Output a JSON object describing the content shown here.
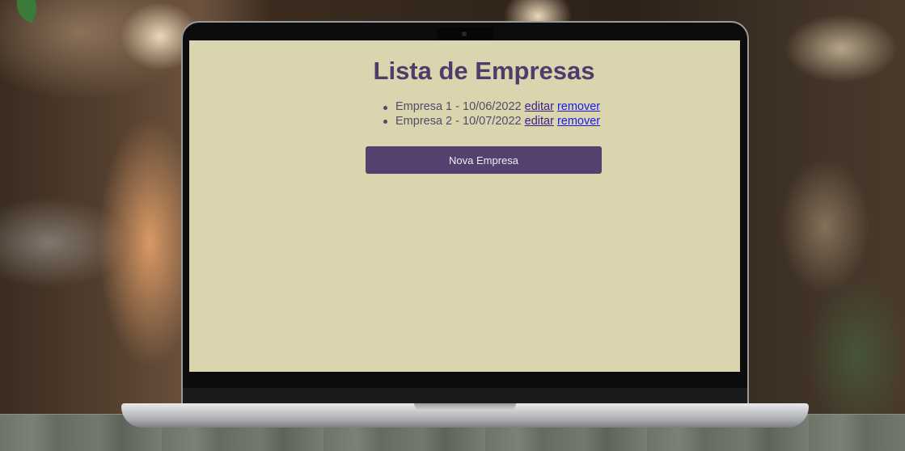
{
  "page": {
    "title": "Lista de Empresas",
    "companies": [
      {
        "name": "Empresa 1",
        "date": "10/06/2022",
        "separator": " - ",
        "edit_label": "editar",
        "remove_label": "remover"
      },
      {
        "name": "Empresa 2",
        "date": "10/07/2022",
        "separator": " - ",
        "edit_label": "editar",
        "remove_label": "remover"
      }
    ],
    "new_button_label": "Nova Empresa"
  },
  "colors": {
    "screen_background": "#dad5ae",
    "title": "#4e3d6b",
    "button_background": "#54416d",
    "link_editar": "#3a1f8a",
    "link_remover": "#1a1aee"
  },
  "icons": {
    "list_bullet": "bullet-icon"
  }
}
